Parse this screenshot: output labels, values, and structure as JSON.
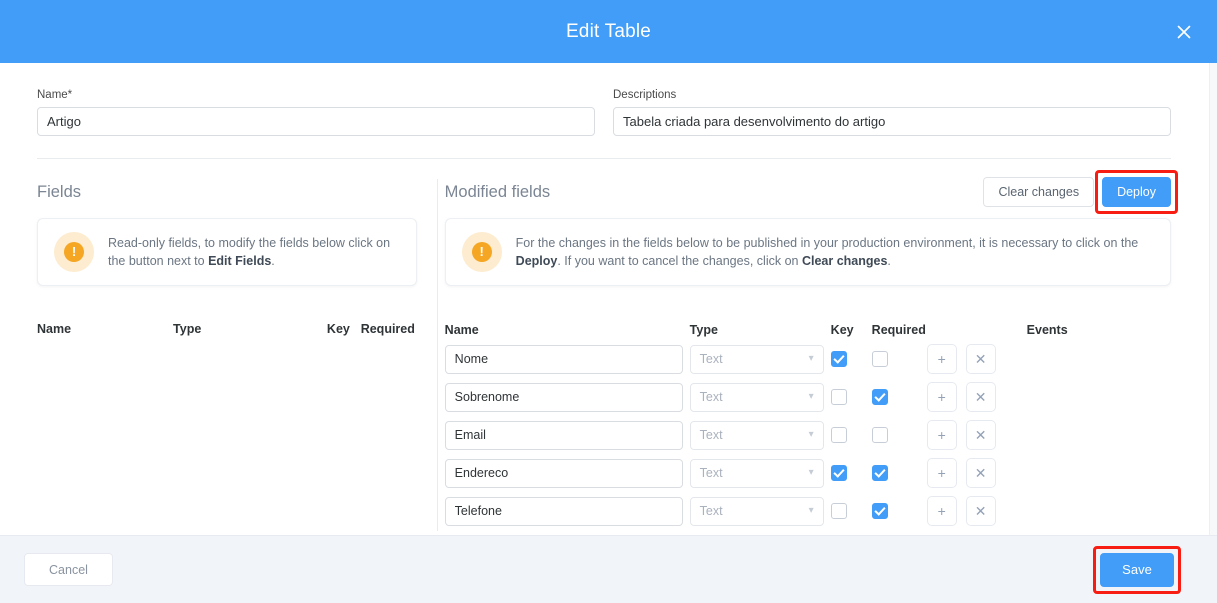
{
  "background_card": {
    "button_label": ""
  },
  "header": {
    "title": "Edit Table",
    "close_icon": "close-icon",
    "bg_color": "#419df7"
  },
  "form": {
    "name": {
      "label": "Name*",
      "value": "Artigo",
      "placeholder": ""
    },
    "descriptions": {
      "label": "Descriptions",
      "value": "Tabela criada para desenvolvimento do artigo",
      "placeholder": ""
    }
  },
  "left_panel": {
    "title": "Fields",
    "alert": {
      "icon": "exclamation-icon",
      "text_before": "Read-only fields, to modify the fields below click on the button next to ",
      "text_bold": "Edit Fields",
      "text_after": "."
    },
    "columns": [
      "Name",
      "Type",
      "Key",
      "Required"
    ],
    "rows": []
  },
  "right_panel": {
    "title": "Modified fields",
    "clear_changes_label": "Clear changes",
    "deploy_label": "Deploy",
    "deploy_highlight_color": "#f81d12",
    "alert": {
      "icon": "exclamation-icon",
      "text_1": "For the changes in the fields below to be published in your production environment, it is necessary to click on the ",
      "bold_1": "Deploy",
      "text_2": ". If you want to cancel the changes, click on ",
      "bold_2": "Clear changes",
      "text_3": "."
    },
    "columns": {
      "name": "Name",
      "type": "Type",
      "key": "Key",
      "required": "Required",
      "events": "Events"
    },
    "add_icon": "plus-icon",
    "remove_icon": "close-small-icon",
    "rows": [
      {
        "name": "Nome",
        "type": "Text",
        "key": true,
        "required": false
      },
      {
        "name": "Sobrenome",
        "type": "Text",
        "key": false,
        "required": true
      },
      {
        "name": "Email",
        "type": "Text",
        "key": false,
        "required": false
      },
      {
        "name": "Endereco",
        "type": "Text",
        "key": true,
        "required": true
      },
      {
        "name": "Telefone",
        "type": "Text",
        "key": false,
        "required": true
      }
    ]
  },
  "footer": {
    "cancel_label": "Cancel",
    "save_label": "Save",
    "save_highlight_color": "#f81d12"
  },
  "colors": {
    "accent": "#419df7",
    "alert_icon": "#f5a623",
    "highlight": "#f81d12"
  }
}
